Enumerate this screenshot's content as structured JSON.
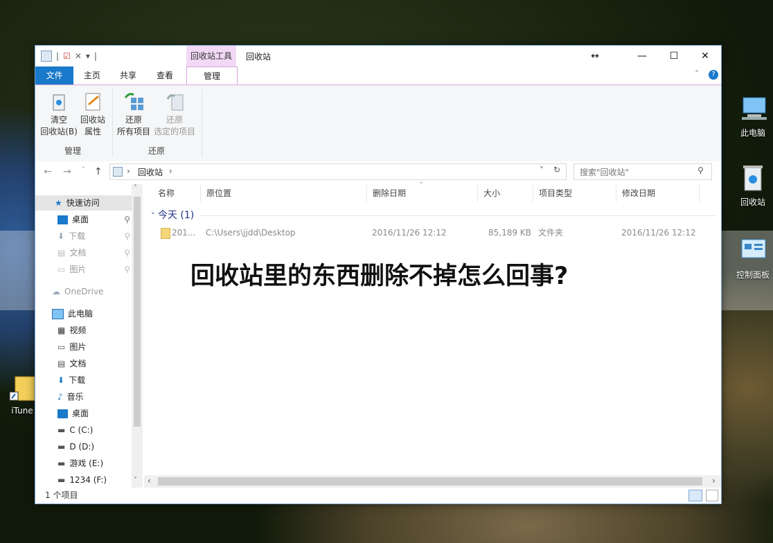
{
  "desktop": {
    "icons": [
      {
        "label": "此电脑"
      },
      {
        "label": "回收站"
      },
      {
        "label": "控制面板"
      },
      {
        "label": "iTune"
      }
    ]
  },
  "window": {
    "title": "回收站",
    "context_tab": "回收站工具",
    "ribbon_tabs": [
      "文件",
      "主页",
      "共享",
      "查看",
      "管理"
    ],
    "ribbon": {
      "empty_bin": {
        "line1": "清空",
        "line2": "回收站(B)"
      },
      "bin_props": {
        "line1": "回收站",
        "line2": "属性"
      },
      "group_manage": "管理",
      "restore_all": {
        "line1": "还原",
        "line2": "所有项目"
      },
      "restore_selected": {
        "line1": "还原",
        "line2": "选定的项目"
      },
      "group_restore": "还原"
    },
    "address": {
      "crumb": "回收站",
      "separator": "›"
    },
    "search": {
      "placeholder": "搜索\"回收站\""
    },
    "nav_pane": {
      "quick_access": "快速访问",
      "items": [
        {
          "label": "桌面"
        },
        {
          "label": "下载"
        },
        {
          "label": "文档"
        },
        {
          "label": "图片"
        }
      ],
      "onedrive": "OneDrive",
      "this_pc": "此电脑",
      "pc_items": [
        {
          "label": "视频"
        },
        {
          "label": "图片"
        },
        {
          "label": "文档"
        },
        {
          "label": "下载"
        },
        {
          "label": "音乐"
        },
        {
          "label": "桌面"
        },
        {
          "label": "C (C:)"
        },
        {
          "label": "D (D:)"
        },
        {
          "label": "游戏 (E:)"
        },
        {
          "label": "1234 (F:)"
        }
      ]
    },
    "columns": [
      "名称",
      "原位置",
      "删除日期",
      "大小",
      "项目类型",
      "修改日期"
    ],
    "group_header": "今天 (1)",
    "rows": [
      {
        "name": "201...",
        "location": "C:\\Users\\jjdd\\Desktop",
        "deleted": "2016/11/26 12:12",
        "size": "85,189 KB",
        "type": "文件夹",
        "modified": "2016/11/26 12:12"
      }
    ],
    "status": "1 个项目"
  },
  "overlay_text": "回收站里的东西删除不掉怎么回事?"
}
